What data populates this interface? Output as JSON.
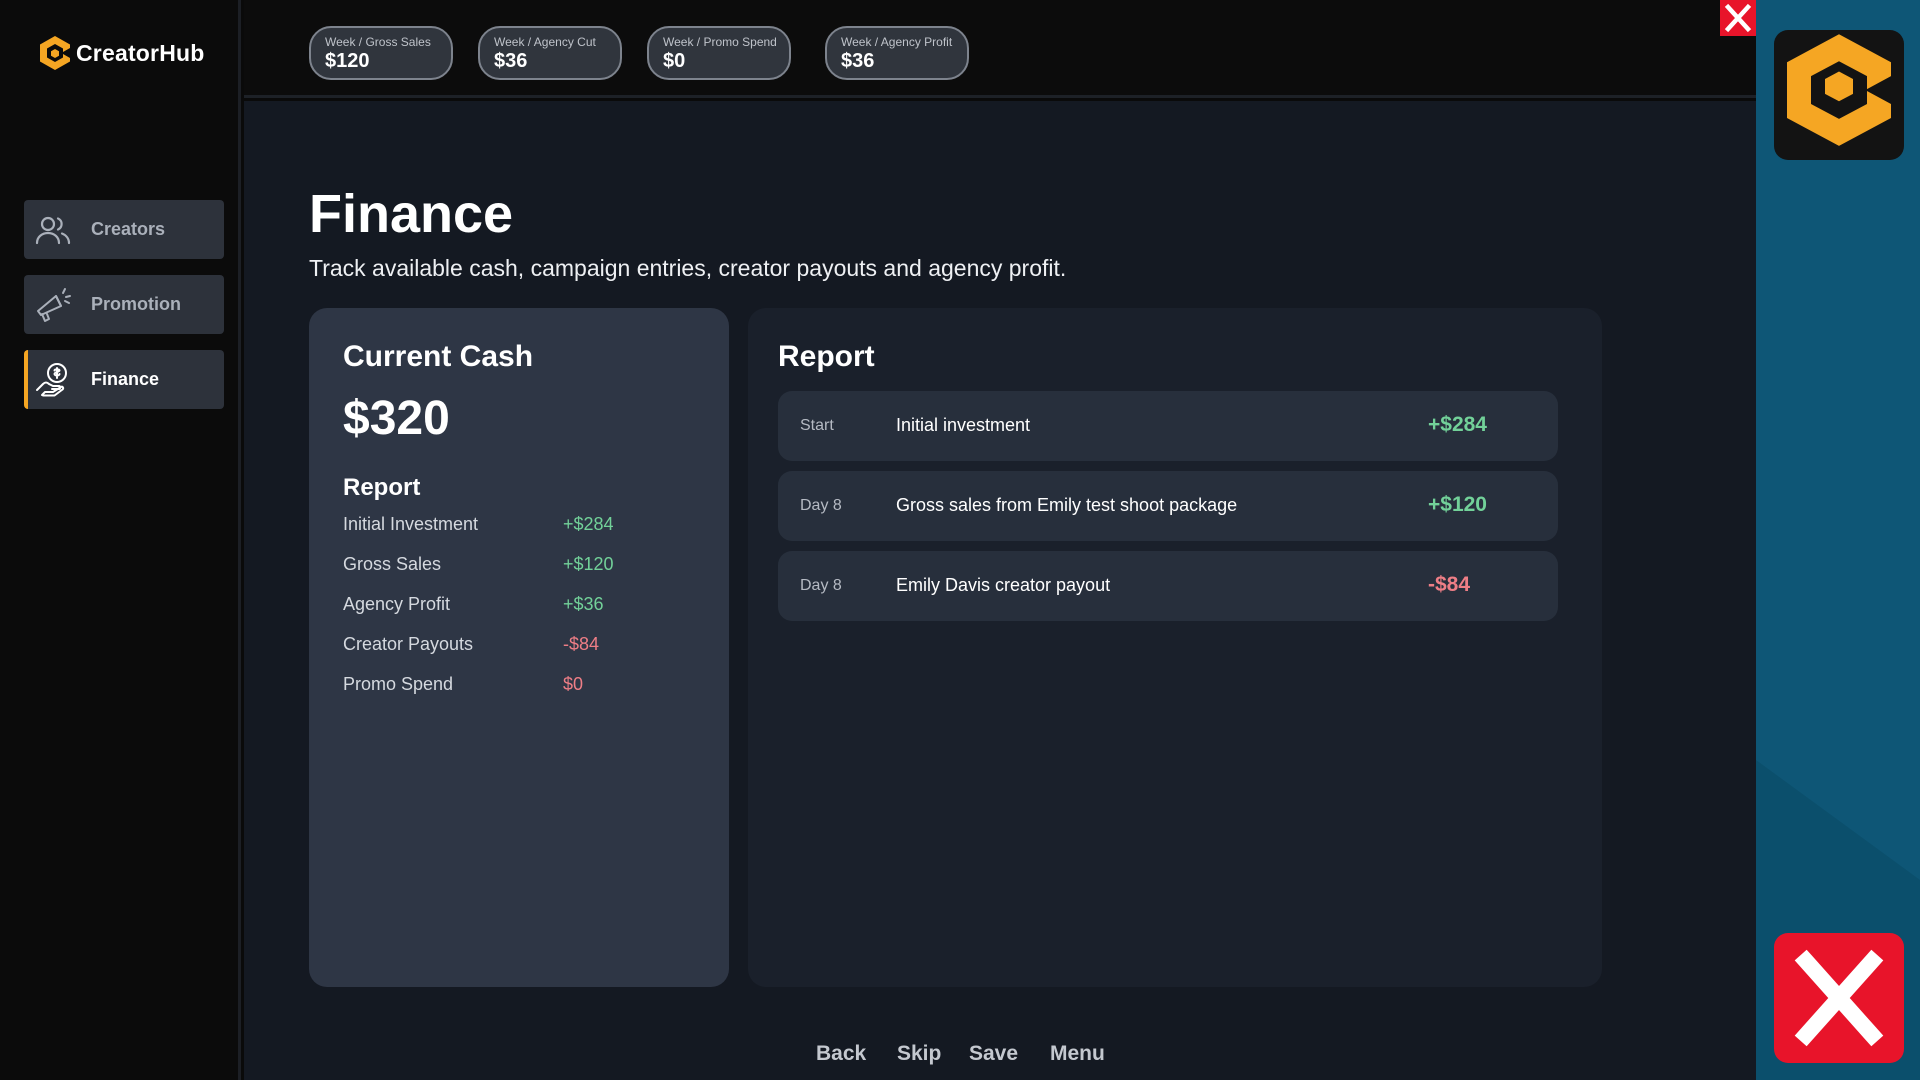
{
  "app": {
    "name": "CreatorHub"
  },
  "sidebar": {
    "items": [
      {
        "label": "Creators",
        "icon": "users-icon",
        "active": false
      },
      {
        "label": "Promotion",
        "icon": "megaphone-icon",
        "active": false
      },
      {
        "label": "Finance",
        "icon": "money-hand-icon",
        "active": true
      }
    ]
  },
  "stats": [
    {
      "label": "Week / Gross Sales",
      "value": "$120"
    },
    {
      "label": "Week / Agency Cut",
      "value": "$36"
    },
    {
      "label": "Week / Promo Spend",
      "value": "$0"
    },
    {
      "label": "Week / Agency Profit",
      "value": "$36"
    }
  ],
  "page": {
    "title": "Finance",
    "subtitle": "Track available cash, campaign entries, creator payouts and agency profit."
  },
  "cash": {
    "title": "Current Cash",
    "value": "$320",
    "report_title": "Report",
    "rows": [
      {
        "label": "Initial Investment",
        "value": "+$284",
        "tone": "pos"
      },
      {
        "label": "Gross Sales",
        "value": "+$120",
        "tone": "pos"
      },
      {
        "label": "Agency Profit",
        "value": "+$36",
        "tone": "pos"
      },
      {
        "label": "Creator Payouts",
        "value": "-$84",
        "tone": "neg"
      },
      {
        "label": "Promo Spend",
        "value": "$0",
        "tone": "neg"
      }
    ]
  },
  "report": {
    "title": "Report",
    "entries": [
      {
        "day": "Start",
        "desc": "Initial investment",
        "amount": "+$284",
        "tone": "pos"
      },
      {
        "day": "Day 8",
        "desc": "Gross sales from Emily test shoot package",
        "amount": "+$120",
        "tone": "pos"
      },
      {
        "day": "Day 8",
        "desc": "Emily Davis creator payout",
        "amount": "-$84",
        "tone": "neg"
      }
    ]
  },
  "footer_menu": [
    "Back",
    "Skip",
    "Save",
    "Menu"
  ],
  "overlay": {
    "close_glyph": "X"
  },
  "colors": {
    "accent": "#f5a623",
    "positive": "#72d199",
    "negative": "#ee7e86",
    "close_red": "#e8142a",
    "ad_blue": "#0b4f6c"
  }
}
